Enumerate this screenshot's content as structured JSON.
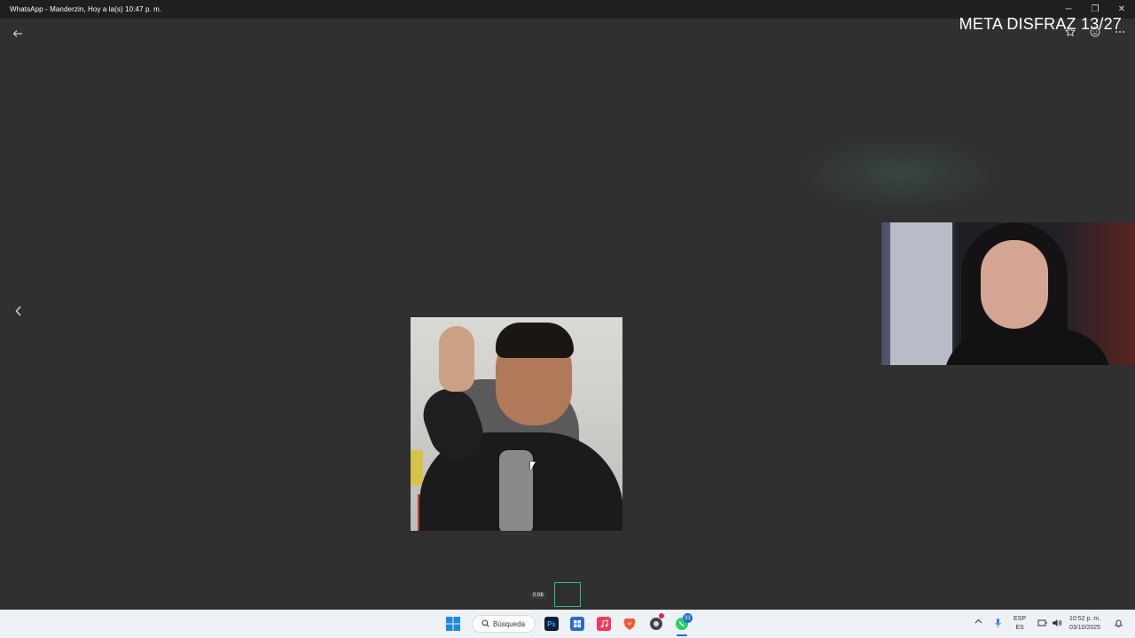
{
  "window": {
    "title": "WhatsApp - Manderzin, Hoy a la(s) 10:47 p. m.",
    "controls": {
      "minimize": "─",
      "restore": "❐",
      "close": "✕"
    }
  },
  "viewer": {
    "overlay_text": "META DISFRAZ 13/27",
    "video_time": "0:08",
    "icons": [
      "back-arrow-icon",
      "chevron-left-icon",
      "star-icon",
      "emoji-icon",
      "more-icon"
    ]
  },
  "taskbar": {
    "search_label": "Búsqueda",
    "apps": [
      "windows-start-icon",
      "photoshop-icon",
      "microsoft-store-icon",
      "music-icon",
      "brave-icon",
      "chrome-icon",
      "whatsapp-icon"
    ],
    "ps_label": "Ps",
    "notifications_badge": "31",
    "language": "ESP",
    "keyboard": "ES",
    "time": "10:52 p. m.",
    "date": "03/10/2025",
    "accent": "#1f6fd6"
  }
}
